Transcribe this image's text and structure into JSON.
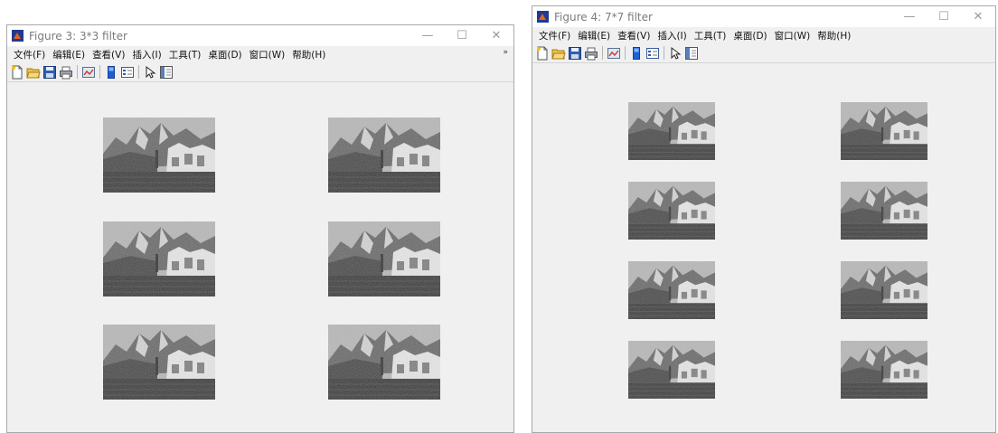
{
  "figures": [
    {
      "id": "fig3",
      "title": "Figure 3: 3*3 filter",
      "subplot_rows": 3,
      "subplot_cols": 2,
      "menu": [
        "文件(F)",
        "编辑(E)",
        "查看(V)",
        "插入(I)",
        "工具(T)",
        "桌面(D)",
        "窗口(W)",
        "帮助(H)"
      ],
      "menu_overflow_icon": "double-chevron-right-icon",
      "toolbar_icons": [
        "new-figure-icon",
        "open-file-icon",
        "save-icon",
        "print-icon",
        "|",
        "link-plot-icon",
        "|",
        "insert-colorbar-icon",
        "insert-legend-icon",
        "|",
        "pointer-icon",
        "property-inspector-icon"
      ],
      "window_controls": [
        "minimize-icon",
        "maximize-icon",
        "close-icon"
      ]
    },
    {
      "id": "fig4",
      "title": "Figure 4: 7*7 filter",
      "subplot_rows": 4,
      "subplot_cols": 2,
      "menu": [
        "文件(F)",
        "编辑(E)",
        "查看(V)",
        "插入(I)",
        "工具(T)",
        "桌面(D)",
        "窗口(W)",
        "帮助(H)"
      ],
      "menu_overflow_icon": "",
      "toolbar_icons": [
        "new-figure-icon",
        "open-file-icon",
        "save-icon",
        "print-icon",
        "|",
        "link-plot-icon",
        "|",
        "insert-colorbar-icon",
        "insert-legend-icon",
        "|",
        "pointer-icon",
        "property-inspector-icon"
      ],
      "window_controls": [
        "minimize-icon",
        "maximize-icon",
        "close-icon"
      ]
    }
  ],
  "window_control_glyphs": {
    "minimize-icon": "—",
    "maximize-icon": "☐",
    "close-icon": "✕"
  },
  "colors": {
    "window_bg": "#f0f0f0",
    "titlebar_bg": "#ffffff",
    "title_text": "#7b7b7b",
    "app_icon_blue": "#1f3a93",
    "app_icon_orange": "#e8621a"
  }
}
